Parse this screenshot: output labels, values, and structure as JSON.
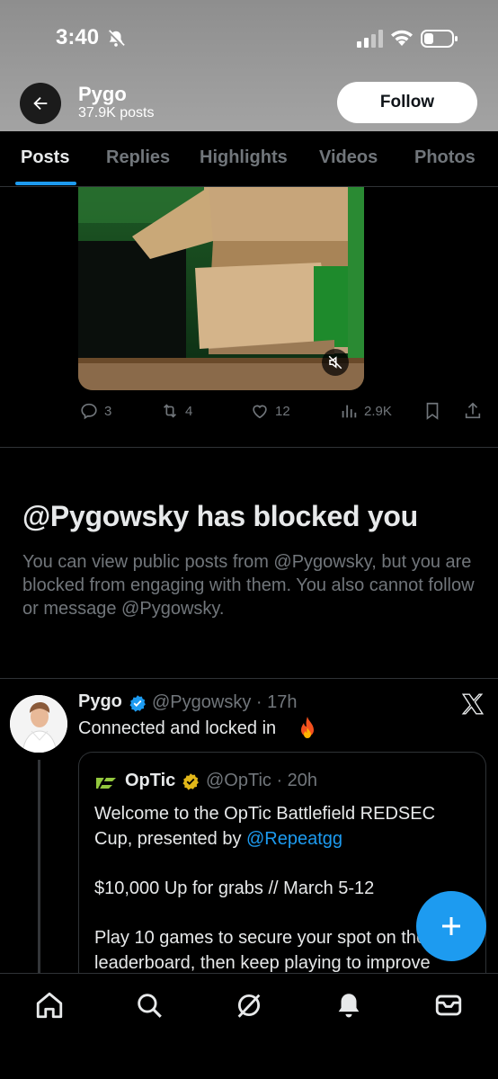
{
  "status_bar": {
    "time": "3:40"
  },
  "header": {
    "name": "Pygo",
    "post_count": "37.9K posts",
    "follow_label": "Follow"
  },
  "tabs": [
    {
      "label": "Posts",
      "active": true
    },
    {
      "label": "Replies",
      "active": false
    },
    {
      "label": "Highlights",
      "active": false
    },
    {
      "label": "Videos",
      "active": false
    },
    {
      "label": "Photos",
      "active": false
    }
  ],
  "post_actions": {
    "replies": "3",
    "reposts": "4",
    "likes": "12",
    "views": "2.9K"
  },
  "blocked": {
    "title": "@Pygowsky has blocked you",
    "body": "You can view public posts from @Pygowsky, but you are blocked from engaging with them. You also cannot follow or message @Pygowsky."
  },
  "tweet": {
    "name": "Pygo",
    "handle_time": "@Pygowsky · 17h",
    "text": "Connected and locked in"
  },
  "quote": {
    "name": "OpTic",
    "handle_time": "@OpTic · 20h",
    "line1": "Welcome to the OpTic Battlefield REDSEC Cup, presented by ",
    "mention": "@Repeatgg",
    "line2": "$10,000 Up for grabs // March 5-12",
    "line3": "Play 10 games to secure your spot on the leaderboard, then keep playing to improve"
  },
  "colors": {
    "accent": "#1d9bf0",
    "text_primary": "#e7e9ea",
    "text_secondary": "#71767b",
    "divider": "#2f3336",
    "optic_green": "#93c83e",
    "gold_badge": "#e2b719"
  },
  "icons": [
    "back-arrow-icon",
    "bell-off-icon",
    "signal-icon",
    "wifi-icon",
    "battery-icon",
    "reply-icon",
    "repost-icon",
    "like-icon",
    "views-icon",
    "bookmark-icon",
    "share-icon",
    "mute-icon",
    "verified-icon",
    "x-logo-icon",
    "fire-icon",
    "plus-icon",
    "home-icon",
    "search-icon",
    "grok-icon",
    "notifications-icon",
    "messages-icon"
  ]
}
